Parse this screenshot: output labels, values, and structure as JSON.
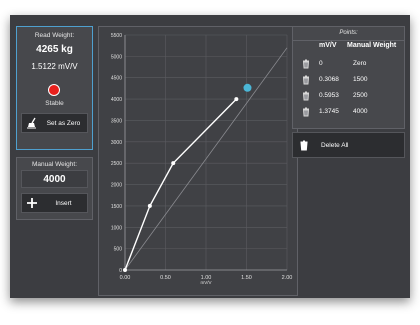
{
  "read": {
    "title": "Read Weight:",
    "weight": "4265 kg",
    "signal": "1.5122 mV/V",
    "status": "Stable",
    "status_color": "#e8201d",
    "set_zero_label": "Set as Zero",
    "set_zero_icon": "broom-icon"
  },
  "manual": {
    "title": "Manual Weight:",
    "value": "4000",
    "insert_label": "Insert",
    "insert_icon": "plus-icon"
  },
  "points": {
    "title": "Points:",
    "col_mv": "mV/V",
    "col_weight": "Manual Weight",
    "rows": [
      {
        "mv": "0",
        "weight": "Zero"
      },
      {
        "mv": "0.3068",
        "weight": "1500"
      },
      {
        "mv": "0.5953",
        "weight": "2500"
      },
      {
        "mv": "1.3745",
        "weight": "4000"
      }
    ],
    "delete_all_label": "Delete All",
    "delete_icon": "trash-icon"
  },
  "chart_data": {
    "type": "line",
    "xlabel": "mV/V",
    "ylabel": "",
    "xlim": [
      0,
      2.0
    ],
    "ylim": [
      0,
      5500
    ],
    "x_ticks": [
      "0.00",
      "0.50",
      "1.00",
      "1.50",
      "2.00"
    ],
    "y_ticks": [
      "0",
      "500",
      "1000",
      "1500",
      "2000",
      "2500",
      "3000",
      "3500",
      "4000",
      "4500",
      "5000",
      "5500"
    ],
    "grid": true,
    "series": [
      {
        "values": [
          [
            0,
            0
          ],
          [
            0.3068,
            1500
          ],
          [
            0.5953,
            2500
          ],
          [
            1.3745,
            4000
          ]
        ],
        "color": "#ffffff"
      }
    ],
    "reference_line": {
      "from": [
        0,
        0
      ],
      "to": [
        2.0,
        5200
      ],
      "color": "#8a8b90"
    },
    "current_point": {
      "x": 1.5122,
      "y": 4265,
      "color": "#4bb6d6"
    }
  }
}
